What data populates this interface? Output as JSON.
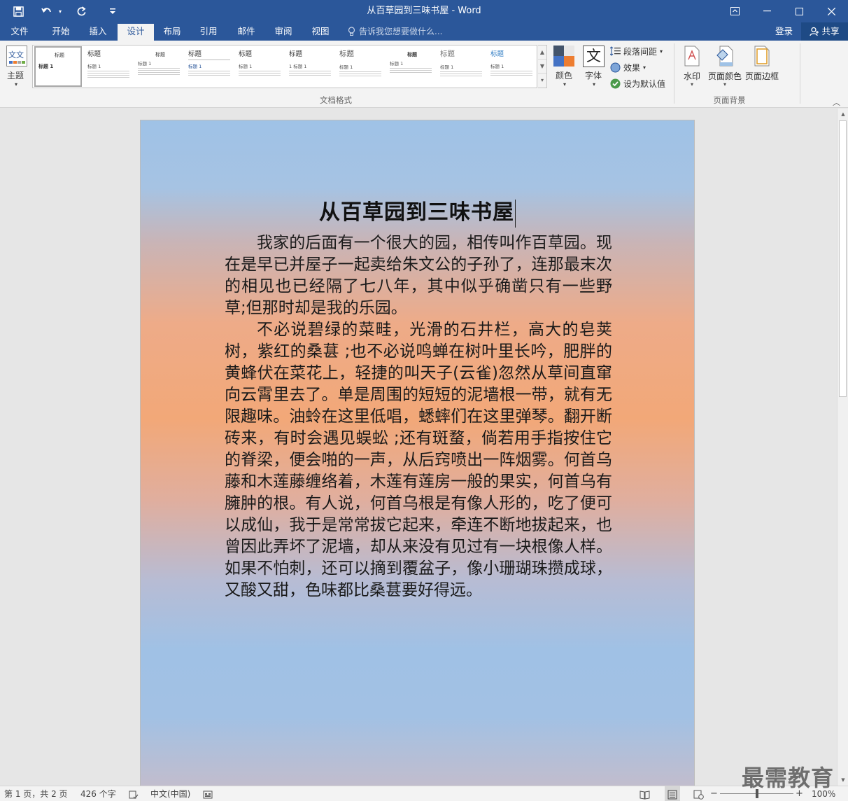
{
  "window": {
    "title": "从百草园到三味书屋 - Word"
  },
  "tabs": [
    {
      "label": "文件"
    },
    {
      "label": "开始"
    },
    {
      "label": "插入"
    },
    {
      "label": "设计",
      "active": true
    },
    {
      "label": "布局"
    },
    {
      "label": "引用"
    },
    {
      "label": "邮件"
    },
    {
      "label": "审阅"
    },
    {
      "label": "视图"
    }
  ],
  "tellme": {
    "placeholder": "告诉我您想要做什么..."
  },
  "account": {
    "login": "登录",
    "share": "共享"
  },
  "ribbon": {
    "theme_label": "主题",
    "theme_icon_text": "文文",
    "gallery": [
      {
        "heading": "标题",
        "sub": "标题 1"
      },
      {
        "heading": "标题",
        "sub": "标题 1"
      },
      {
        "heading": "标题",
        "sub": "标题 1"
      },
      {
        "heading": "标题",
        "sub": "标题 1"
      },
      {
        "heading": "标题",
        "sub": "标题 1"
      },
      {
        "heading": "标题",
        "sub": "1  标题 1"
      },
      {
        "heading": "标题",
        "sub": "标题 1"
      },
      {
        "heading": "标题",
        "sub": "标题 1"
      },
      {
        "heading": "标题",
        "sub": "标题 1"
      },
      {
        "heading": "标题",
        "sub": "标题 1"
      }
    ],
    "doc_format_group": "文档格式",
    "colors_label": "颜色",
    "fonts_label": "字体",
    "fonts_icon_text": "文",
    "paragraph_spacing": "段落间距",
    "effects": "效果",
    "set_default": "设为默认值",
    "watermark": "水印",
    "page_color": "页面颜色",
    "page_borders": "页面边框",
    "page_background_group": "页面背景"
  },
  "document": {
    "heading": "从百草园到三味书屋",
    "paragraphs": [
      "我家的后面有一个很大的园，相传叫作百草园。现在是早已并屋子一起卖给朱文公的子孙了，连那最末次的相见也已经隔了七八年，其中似乎确凿只有一些野草;但那时却是我的乐园。",
      "不必说碧绿的菜畦，光滑的石井栏，高大的皂荚树，紫红的桑葚 ;也不必说鸣蝉在树叶里长吟，肥胖的黄蜂伏在菜花上，轻捷的叫天子(云雀)忽然从草间直窜向云霄里去了。单是周围的短短的泥墙根一带，就有无限趣味。油蛉在这里低唱，蟋蟀们在这里弹琴。翻开断砖来，有时会遇见蜈蚣 ;还有斑蝥，倘若用手指按住它的脊梁，便会啪的一声，从后窍喷出一阵烟雾。何首乌藤和木莲藤缠络着，木莲有莲房一般的果实，何首乌有臃肿的根。有人说，何首乌根是有像人形的，吃了便可以成仙，我于是常常拔它起来，牵连不断地拔起来，也曾因此弄坏了泥墙，却从来没有见过有一块根像人样。如果不怕刺，还可以摘到覆盆子，像小珊瑚珠攒成球，又酸又甜，色味都比桑葚要好得远。"
    ]
  },
  "status": {
    "page": "第 1 页，共 2 页",
    "words": "426 个字",
    "language": "中文(中国)",
    "zoom": "100%",
    "zoom_minus": "−",
    "zoom_plus": "+"
  },
  "watermark_text": "最需教育",
  "colors": {
    "title_bar": "#2b579a",
    "ribbon_bg": "#f3f3f3",
    "workspace": "#e6e6e6",
    "page_gradient_top": "#9fc2e6",
    "page_gradient_mid": "#f2a878"
  }
}
